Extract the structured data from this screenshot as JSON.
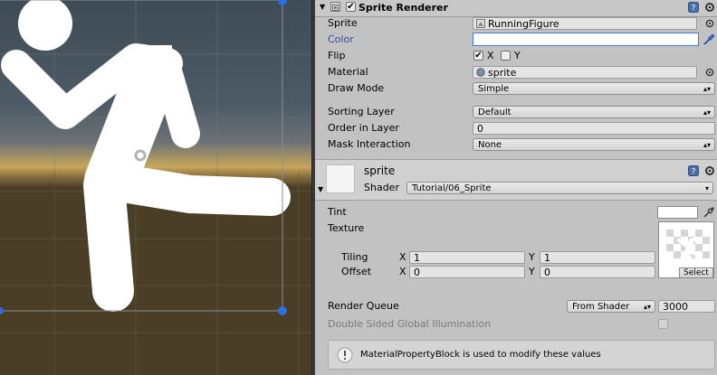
{
  "sprite_renderer": {
    "title": "Sprite Renderer",
    "enabled": true,
    "fields": {
      "sprite_label": "Sprite",
      "sprite_value": "RunningFigure",
      "color_label": "Color",
      "flip_label": "Flip",
      "flip_x_label": "X",
      "flip_y_label": "Y",
      "flip_x": true,
      "flip_y": false,
      "material_label": "Material",
      "material_value": "sprite",
      "draw_mode_label": "Draw Mode",
      "draw_mode_value": "Simple",
      "sorting_layer_label": "Sorting Layer",
      "sorting_layer_value": "Default",
      "order_label": "Order in Layer",
      "order_value": "0",
      "mask_label": "Mask Interaction",
      "mask_value": "None"
    }
  },
  "material": {
    "name": "sprite",
    "shader_label": "Shader",
    "shader_value": "Tutorial/06_Sprite",
    "tint_label": "Tint",
    "texture_label": "Texture",
    "tiling_label": "Tiling",
    "offset_label": "Offset",
    "x_label": "X",
    "y_label": "Y",
    "tiling_x": "1",
    "tiling_y": "1",
    "offset_x": "0",
    "offset_y": "0",
    "select_label": "Select",
    "render_queue_label": "Render Queue",
    "render_queue_mode": "From Shader",
    "render_queue_value": "3000",
    "dsgi_label": "Double Sided Global Illumination",
    "info_message": "MaterialPropertyBlock is used to modify these values"
  },
  "colors": {
    "accent_blue": "#2a4ea8",
    "sky_top": "#3e4a52",
    "horizon": "#c9a85a",
    "ground": "#4a3e27",
    "handle_blue": "#2d6fe0"
  },
  "icons": [
    "help-icon",
    "settings-icon",
    "color-picker-icon",
    "info-icon",
    "object-picker-icon"
  ]
}
